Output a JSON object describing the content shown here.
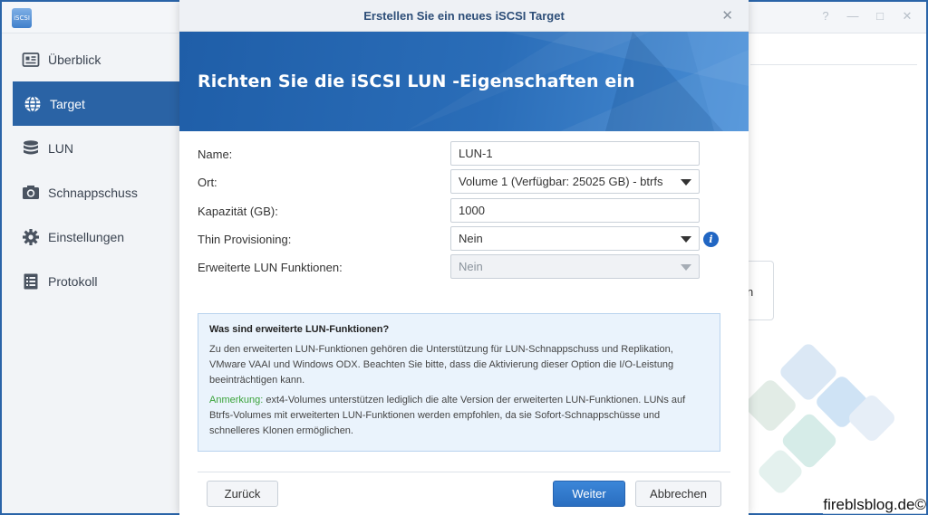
{
  "app": {
    "icon_text": "iSCSI",
    "window_controls": [
      "?",
      "—",
      "□",
      "✕"
    ]
  },
  "sidebar": {
    "items": [
      {
        "label": "Überblick",
        "icon": "overview-icon",
        "active": false
      },
      {
        "label": "Target",
        "icon": "globe-icon",
        "active": true
      },
      {
        "label": "LUN",
        "icon": "database-icon",
        "active": false
      },
      {
        "label": "Schnappschuss",
        "icon": "camera-icon",
        "active": false
      },
      {
        "label": "Einstellungen",
        "icon": "gear-icon",
        "active": false
      },
      {
        "label": "Protokoll",
        "icon": "log-icon",
        "active": false
      }
    ]
  },
  "background": {
    "card_text": "n"
  },
  "dialog": {
    "title": "Erstellen Sie ein neues iSCSI Target",
    "close_symbol": "✕",
    "banner_title": "Richten Sie die iSCSI LUN -Eigenschaften ein",
    "fields": {
      "name": {
        "label": "Name:",
        "value": "LUN-1"
      },
      "location": {
        "label": "Ort:",
        "value": "Volume 1 (Verfügbar: 25025 GB) - btrfs"
      },
      "capacity": {
        "label": "Kapazität (GB):",
        "value": "1000"
      },
      "thin": {
        "label": "Thin Provisioning:",
        "value": "Nein"
      },
      "advanced": {
        "label": "Erweiterte LUN Funktionen:",
        "value": "Nein"
      }
    },
    "info_box": {
      "heading": "Was sind erweiterte LUN-Funktionen?",
      "body": "Zu den erweiterten LUN-Funktionen gehören die Unterstützung für LUN-Schnappschuss und Replikation, VMware VAAI und Windows ODX. Beachten Sie bitte, dass die Aktivierung dieser Option die I/O-Leistung beeinträchtigen kann.",
      "note_label": "Anmerkung:",
      "note_text": " ext4-Volumes unterstützen lediglich die alte Version der erweiterten LUN-Funktionen. LUNs auf Btrfs-Volumes mit erweiterten LUN-Funktionen werden empfohlen, da sie Sofort-Schnappschüsse und schnelleres Klonen ermöglichen."
    },
    "buttons": {
      "back": "Zurück",
      "next": "Weiter",
      "cancel": "Abbrechen"
    }
  },
  "watermark": "fireblsblog.de©",
  "colors": {
    "accent": "#2a63a5",
    "banner": "#1f5ea8",
    "note_green": "#3aa33a",
    "info_bg": "#eaf3fc"
  }
}
